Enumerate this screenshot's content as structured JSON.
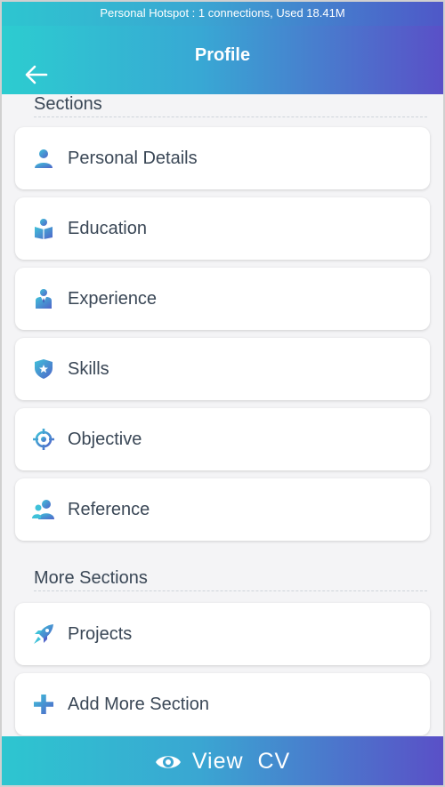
{
  "status_bar": {
    "text": "Personal Hotspot : 1 connections, Used 18.41M"
  },
  "app_bar": {
    "title": "Profile",
    "back_icon": "arrow-left-icon"
  },
  "sections": {
    "heading": "Sections",
    "items": [
      {
        "label": "Personal Details",
        "icon": "person-icon"
      },
      {
        "label": "Education",
        "icon": "book-reader-icon"
      },
      {
        "label": "Experience",
        "icon": "businessman-icon"
      },
      {
        "label": "Skills",
        "icon": "shield-star-icon"
      },
      {
        "label": "Objective",
        "icon": "crosshair-icon"
      },
      {
        "label": "Reference",
        "icon": "people-icon"
      }
    ]
  },
  "more_sections": {
    "heading": "More Sections",
    "items": [
      {
        "label": "Projects",
        "icon": "rocket-icon"
      },
      {
        "label": "Add More Section",
        "icon": "plus-icon"
      }
    ]
  },
  "bottom_button": {
    "label": "View  CV",
    "icon": "eye-icon"
  },
  "colors": {
    "gradient_start": "#2dc6d0",
    "gradient_end": "#5a4fc7",
    "icon_start": "#3fc1d9",
    "icon_end": "#5064c9",
    "text": "#3a4756"
  }
}
